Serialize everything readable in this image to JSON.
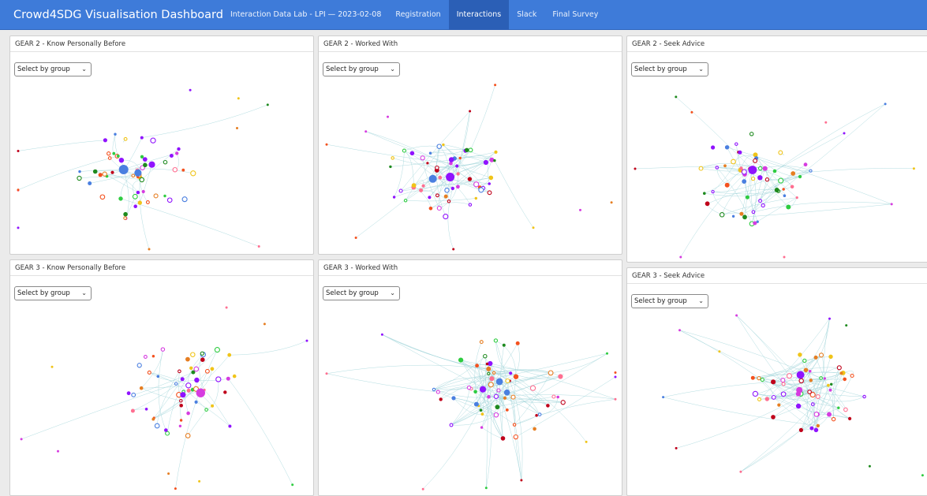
{
  "navbar": {
    "brand": "Crowd4SDG Visualisation Dashboard",
    "subtitle": "Interaction Data Lab - LPI — 2023-02-08",
    "items": [
      {
        "label": "Registration",
        "active": false
      },
      {
        "label": "Interactions",
        "active": true
      },
      {
        "label": "Slack",
        "active": false
      },
      {
        "label": "Final Survey",
        "active": false
      }
    ]
  },
  "panels": [
    {
      "title": "GEAR 2 - Know Personally Before",
      "select": "Select by group"
    },
    {
      "title": "GEAR 2 - Worked With",
      "select": "Select by group"
    },
    {
      "title": "GEAR 2 - Seek Advice",
      "select": "Select by group"
    },
    {
      "title": "GEAR 3 - Know Personally Before",
      "select": "Select by group"
    },
    {
      "title": "GEAR 3 - Worked With",
      "select": "Select by group"
    },
    {
      "title": "GEAR 3 - Seek Advice",
      "select": "Select by group"
    }
  ],
  "colors": {
    "navbar": "#3e7bd9",
    "nav_active": "#2b5fb6",
    "group_colors": [
      "#9013fe",
      "#d63ce0",
      "#4a7fe0",
      "#2ecc40",
      "#f0c419",
      "#e67e22",
      "#f4511e",
      "#c0001a",
      "#ff6f91",
      "#1e8a1e"
    ]
  }
}
